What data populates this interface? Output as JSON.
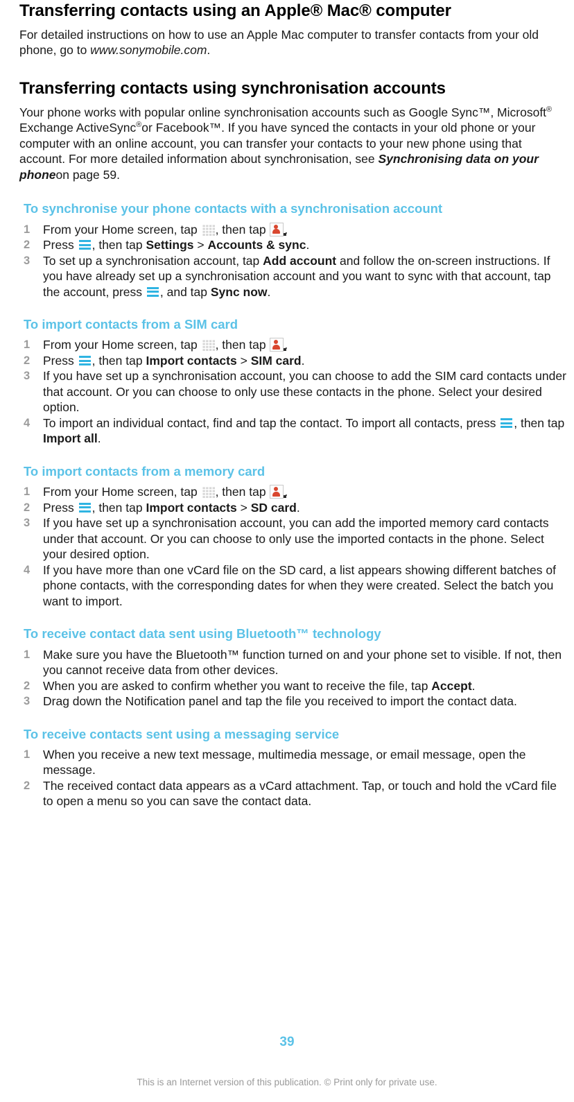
{
  "document": {
    "title": "Transferring contacts using an Apple® Mac® computer",
    "page_number": "39",
    "footer_note": "This is an Internet version of this publication. © Print only for private use.",
    "accent_color": "#5bc2e7",
    "menu_icon_color": "#2fb4e2",
    "contacts_icon_color": "#d9472f",
    "number_color": "#9b9b9b"
  },
  "intro": {
    "text_before_link": "For detailed instructions on how to use an Apple Mac computer to transfer contacts from your old phone, go to ",
    "link": "www.sonymobile.com",
    "text_after_link": "."
  },
  "section": {
    "heading": "Transferring contacts using synchronisation accounts",
    "paragraph": {
      "p1": "Your phone works with popular online synchronisation accounts such as Google Sync™, Microsoft",
      "reg1": "®",
      "p2": " Exchange ActiveSync",
      "reg2": "®",
      "p3": "or Facebook™. If you have synced the contacts in your old phone or your computer with an online account, you can transfer your contacts to your new phone using that account. For more detailed information about synchronisation, see ",
      "italic": "Synchronising data on your phone",
      "p4": "on page 59."
    }
  },
  "procedures": [
    {
      "title": "To synchronise your phone contacts with a synchronisation account",
      "steps": [
        {
          "num": "1",
          "parts": [
            {
              "t": "text",
              "v": "From your Home screen, tap "
            },
            {
              "t": "icon",
              "v": "app-grid-icon"
            },
            {
              "t": "text",
              "v": ", then tap "
            },
            {
              "t": "icon",
              "v": "contacts-icon"
            },
            {
              "t": "text",
              "v": "."
            }
          ]
        },
        {
          "num": "2",
          "parts": [
            {
              "t": "text",
              "v": "Press "
            },
            {
              "t": "icon",
              "v": "menu-icon"
            },
            {
              "t": "text",
              "v": ", then tap "
            },
            {
              "t": "bold",
              "v": "Settings"
            },
            {
              "t": "text",
              "v": " > "
            },
            {
              "t": "bold",
              "v": "Accounts & sync"
            },
            {
              "t": "text",
              "v": "."
            }
          ]
        },
        {
          "num": "3",
          "parts": [
            {
              "t": "text",
              "v": "To set up a synchronisation account, tap "
            },
            {
              "t": "bold",
              "v": "Add account"
            },
            {
              "t": "text",
              "v": " and follow the on-screen instructions. If you have already set up a synchronisation account and you want to sync with that account, tap the account, press "
            },
            {
              "t": "icon",
              "v": "menu-icon"
            },
            {
              "t": "text",
              "v": ", and tap "
            },
            {
              "t": "bold",
              "v": "Sync now"
            },
            {
              "t": "text",
              "v": "."
            }
          ]
        }
      ]
    },
    {
      "title": "To import contacts from a SIM card",
      "steps": [
        {
          "num": "1",
          "parts": [
            {
              "t": "text",
              "v": "From your Home screen, tap "
            },
            {
              "t": "icon",
              "v": "app-grid-icon"
            },
            {
              "t": "text",
              "v": ", then tap "
            },
            {
              "t": "icon",
              "v": "contacts-icon"
            },
            {
              "t": "text",
              "v": "."
            }
          ]
        },
        {
          "num": "2",
          "parts": [
            {
              "t": "text",
              "v": "Press "
            },
            {
              "t": "icon",
              "v": "menu-icon"
            },
            {
              "t": "text",
              "v": ", then tap "
            },
            {
              "t": "bold",
              "v": "Import contacts"
            },
            {
              "t": "text",
              "v": " > "
            },
            {
              "t": "bold",
              "v": "SIM card"
            },
            {
              "t": "text",
              "v": "."
            }
          ]
        },
        {
          "num": "3",
          "parts": [
            {
              "t": "text",
              "v": "If you have set up a synchronisation account, you can choose to add the SIM card contacts under that account. Or you can choose to only use these contacts in the phone. Select your desired option."
            }
          ]
        },
        {
          "num": "4",
          "parts": [
            {
              "t": "text",
              "v": "To import an individual contact, find and tap the contact. To import all contacts, press "
            },
            {
              "t": "icon",
              "v": "menu-icon"
            },
            {
              "t": "text",
              "v": ", then tap "
            },
            {
              "t": "bold",
              "v": "Import all"
            },
            {
              "t": "text",
              "v": "."
            }
          ]
        }
      ]
    },
    {
      "title": "To import contacts from a memory card",
      "steps": [
        {
          "num": "1",
          "parts": [
            {
              "t": "text",
              "v": "From your Home screen, tap "
            },
            {
              "t": "icon",
              "v": "app-grid-icon"
            },
            {
              "t": "text",
              "v": ", then tap "
            },
            {
              "t": "icon",
              "v": "contacts-icon"
            },
            {
              "t": "text",
              "v": "."
            }
          ]
        },
        {
          "num": "2",
          "parts": [
            {
              "t": "text",
              "v": "Press "
            },
            {
              "t": "icon",
              "v": "menu-icon"
            },
            {
              "t": "text",
              "v": ", then tap "
            },
            {
              "t": "bold",
              "v": "Import contacts"
            },
            {
              "t": "text",
              "v": " > "
            },
            {
              "t": "bold",
              "v": "SD card"
            },
            {
              "t": "text",
              "v": "."
            }
          ]
        },
        {
          "num": "3",
          "parts": [
            {
              "t": "text",
              "v": "If you have set up a synchronisation account, you can add the imported memory card contacts under that account. Or you can choose to only use the imported contacts in the phone. Select your desired option."
            }
          ]
        },
        {
          "num": "4",
          "parts": [
            {
              "t": "text",
              "v": "If you have more than one vCard file on the SD card, a list appears showing different batches of phone contacts, with the corresponding dates for when they were created. Select the batch you want to import."
            }
          ]
        }
      ]
    },
    {
      "title": "To receive contact data sent using Bluetooth™ technology",
      "steps": [
        {
          "num": "1",
          "parts": [
            {
              "t": "text",
              "v": "Make sure you have the Bluetooth™ function turned on and your phone set to visible. If not, then you cannot receive data from other devices."
            }
          ]
        },
        {
          "num": "2",
          "parts": [
            {
              "t": "text",
              "v": "When you are asked to confirm whether you want to receive the file, tap "
            },
            {
              "t": "bold",
              "v": "Accept"
            },
            {
              "t": "text",
              "v": "."
            }
          ]
        },
        {
          "num": "3",
          "parts": [
            {
              "t": "text",
              "v": "Drag down the Notification panel and tap the file you received to import the contact data."
            }
          ]
        }
      ]
    },
    {
      "title": "To receive contacts sent using a messaging service",
      "steps": [
        {
          "num": "1",
          "parts": [
            {
              "t": "text",
              "v": "When you receive a new text message, multimedia message, or email message, open the message."
            }
          ]
        },
        {
          "num": "2",
          "parts": [
            {
              "t": "text",
              "v": "The received contact data appears as a vCard attachment. Tap, or touch and hold the vCard file to open a menu so you can save the contact data."
            }
          ]
        }
      ]
    }
  ]
}
